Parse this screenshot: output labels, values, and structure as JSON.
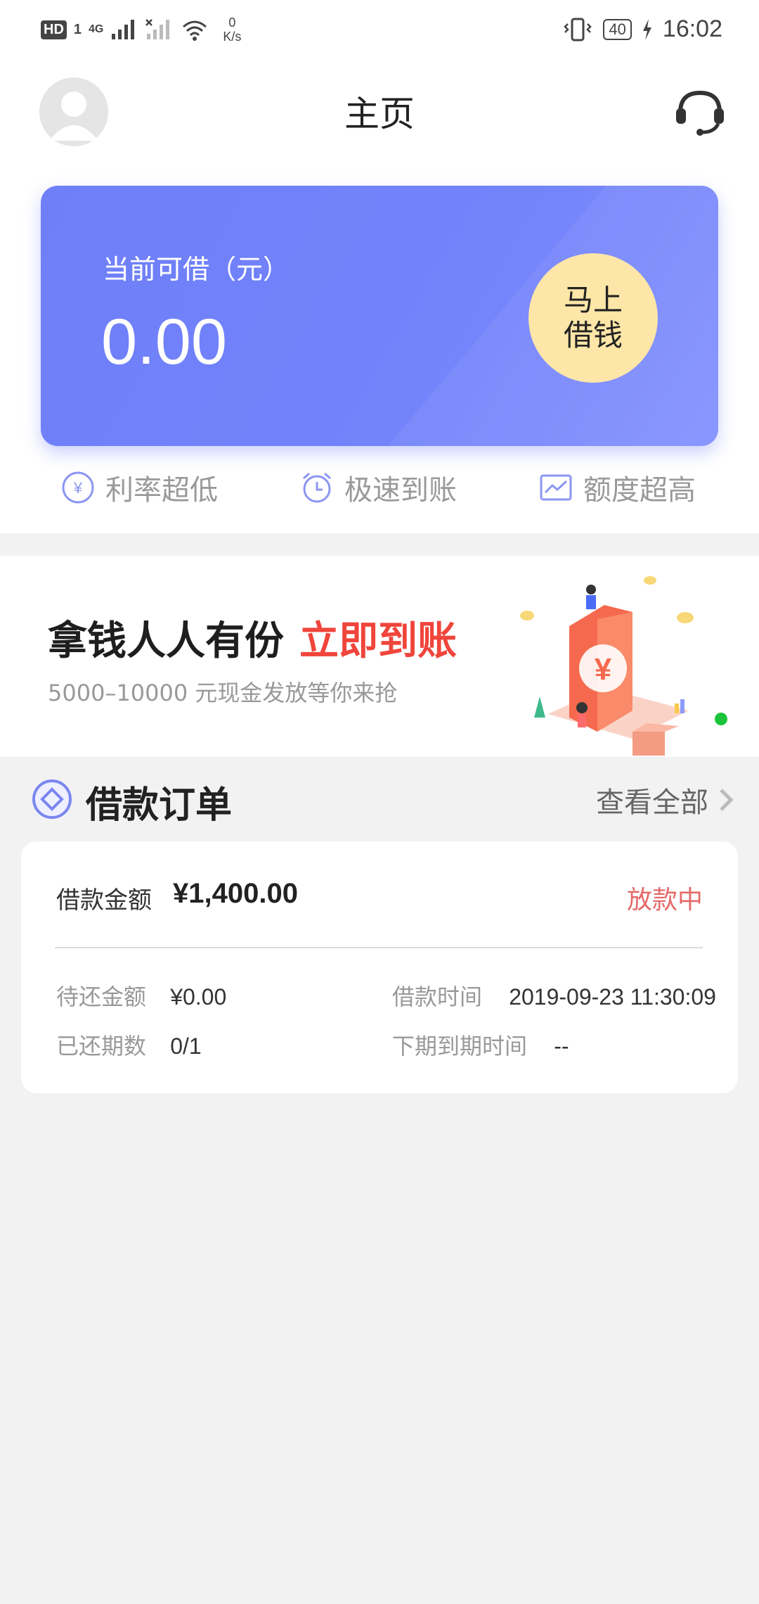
{
  "status_bar": {
    "hd": "HD",
    "sim": "1",
    "network": "4G",
    "speed_value": "0",
    "speed_unit": "K/s",
    "battery": "40",
    "time": "16:02"
  },
  "header": {
    "title": "主页"
  },
  "card": {
    "label": "当前可借（元）",
    "amount": "0.00",
    "button_label": "马上借钱"
  },
  "features": [
    {
      "label": "利率超低",
      "icon": "yuan-circle-icon"
    },
    {
      "label": "极速到账",
      "icon": "alarm-clock-icon"
    },
    {
      "label": "额度超高",
      "icon": "chart-icon"
    }
  ],
  "banner": {
    "title_black": "拿钱人人有份",
    "title_red": "立即到账",
    "subtitle": "5000–10000 元现金发放等你来抢"
  },
  "section": {
    "title": "借款订单",
    "view_all": "查看全部"
  },
  "order": {
    "amount_label": "借款金额",
    "amount_value": "¥1,400.00",
    "status": "放款中",
    "due_label": "待还金额",
    "due_value": "¥0.00",
    "time_label": "借款时间",
    "time_value": "2019-09-23 11:30:09",
    "periods_label": "已还期数",
    "periods_value": "0/1",
    "next_label": "下期到期时间",
    "next_value": "--"
  },
  "colors": {
    "card": "#7383fa",
    "button": "#fde6a8",
    "accent_red": "#f0453b",
    "status_red": "#e46a6a"
  }
}
